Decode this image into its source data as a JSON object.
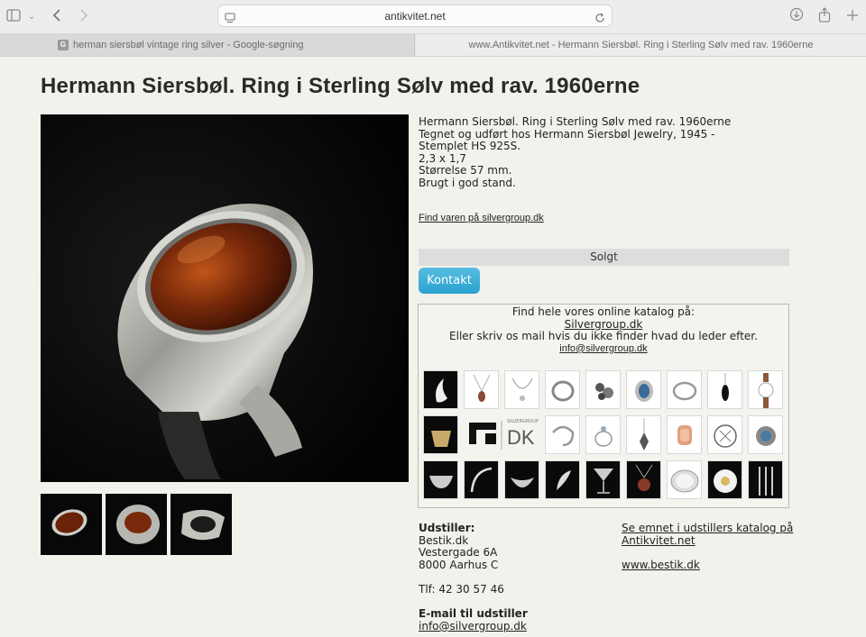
{
  "browser": {
    "url": "antikvitet.net",
    "tabs": [
      {
        "label": "herman siersbøl vintage ring silver - Google-søgning",
        "favicon": "G"
      },
      {
        "label": "www.Antikvitet.net - Hermann Siersbøl. Ring i Sterling Sølv med rav. 1960erne"
      }
    ]
  },
  "product": {
    "title": "Hermann Siersbøl. Ring i Sterling Sølv med rav. 1960erne",
    "description": [
      "Hermann Siersbøl. Ring i Sterling Sølv med rav. 1960erne",
      "Tegnet og udført hos Hermann Siersbøl Jewelry, 1945 -",
      "Stemplet HS 925S.",
      "2,3 x 1,7",
      "Størrelse 57 mm.",
      "Brugt i god stand."
    ],
    "find_link": "Find varen på silvergroup.dk",
    "status": "Solgt",
    "contact_button": "Kontakt"
  },
  "catalog": {
    "line1": "Find hele vores online katalog på:",
    "link": "Silvergroup.dk",
    "line2": "Eller skriv os mail hvis du ikke finder hvad du leder efter.",
    "email": "info@silvergroup.dk",
    "logo_text": "SILVERGROUP",
    "logo_dk": "DK"
  },
  "exhibitor": {
    "heading": "Udstiller:",
    "name": "Bestik.dk",
    "street": "Vestergade 6A",
    "city": "8000 Aarhus C",
    "phone": "Tlf: 42 30 57 46",
    "email_heading": "E-mail til udstiller",
    "email": "info@silvergroup.dk",
    "catalog_link_1": "Se emnet i udstillers katalog på",
    "catalog_link_2": "Antikvitet.net",
    "website": "www.bestik.dk"
  },
  "icons": {
    "sidebar": "sidebar-icon",
    "back": "chevron-left-icon",
    "forward": "chevron-right-icon",
    "download": "download-icon",
    "share": "share-icon",
    "new_tab": "plus-icon",
    "reload": "reload-icon"
  },
  "colors": {
    "page_bg": "#f3f1ec",
    "button_accent": "#2aa2cf",
    "sold_bar": "#dddddd"
  }
}
